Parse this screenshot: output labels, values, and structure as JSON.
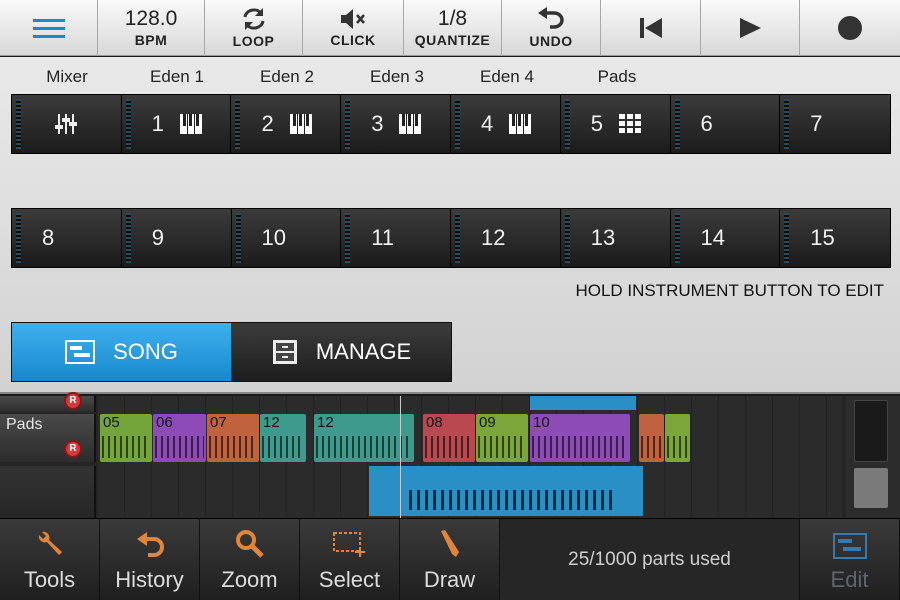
{
  "toolbar": {
    "menu_icon": "hamburger-icon",
    "tempo_value": "128.0",
    "tempo_label": "BPM",
    "loop_label": "LOOP",
    "click_label": "CLICK",
    "quantize_value": "1/8",
    "quantize_label": "QUANTIZE",
    "undo_label": "UNDO",
    "rewind_icon": "skip-back-icon",
    "play_icon": "play-icon",
    "record_icon": "record-icon"
  },
  "instruments": {
    "labels": [
      "Mixer",
      "Eden 1",
      "Eden 2",
      "Eden 3",
      "Eden 4",
      "Pads"
    ],
    "row1": [
      {
        "num": "",
        "icon": "mixer-icon"
      },
      {
        "num": "1",
        "icon": "piano-icon"
      },
      {
        "num": "2",
        "icon": "piano-icon"
      },
      {
        "num": "3",
        "icon": "piano-icon"
      },
      {
        "num": "4",
        "icon": "piano-icon"
      },
      {
        "num": "5",
        "icon": "drum-pads-icon"
      },
      {
        "num": "6",
        "icon": ""
      },
      {
        "num": "7",
        "icon": ""
      }
    ],
    "row2": [
      "8",
      "9",
      "10",
      "11",
      "12",
      "13",
      "14",
      "15"
    ],
    "hint": "HOLD INSTRUMENT BUTTON TO EDIT"
  },
  "modes": {
    "song_label": "SONG",
    "manage_label": "MANAGE",
    "active": "song"
  },
  "tracks": [
    {
      "name": "",
      "record": "R"
    },
    {
      "name": "Pads",
      "record": "R"
    },
    {
      "name": "",
      "record": ""
    }
  ],
  "parts": [
    {
      "label": "05",
      "color": "#74a53a"
    },
    {
      "label": "06",
      "color": "#8d4bb7"
    },
    {
      "label": "07",
      "color": "#c0623e"
    },
    {
      "label": "12",
      "color": "#3e9a8c"
    },
    {
      "label": "12",
      "color": "#3e9a8c"
    },
    {
      "label": "08",
      "color": "#b94850"
    },
    {
      "label": "09",
      "color": "#7aa63a"
    },
    {
      "label": "10",
      "color": "#8d4bb7"
    },
    {
      "label": "",
      "color": "#c0623e"
    },
    {
      "label": "",
      "color": "#7aa63a"
    }
  ],
  "bottom": {
    "tools_label": "Tools",
    "history_label": "History",
    "zoom_label": "Zoom",
    "select_label": "Select",
    "draw_label": "Draw",
    "parts_used": "25/1000 parts used",
    "edit_label": "Edit"
  },
  "colors": {
    "accent": "#2a9fe0",
    "icon_accent": "#e0853a",
    "disabled": "#5c6670"
  }
}
